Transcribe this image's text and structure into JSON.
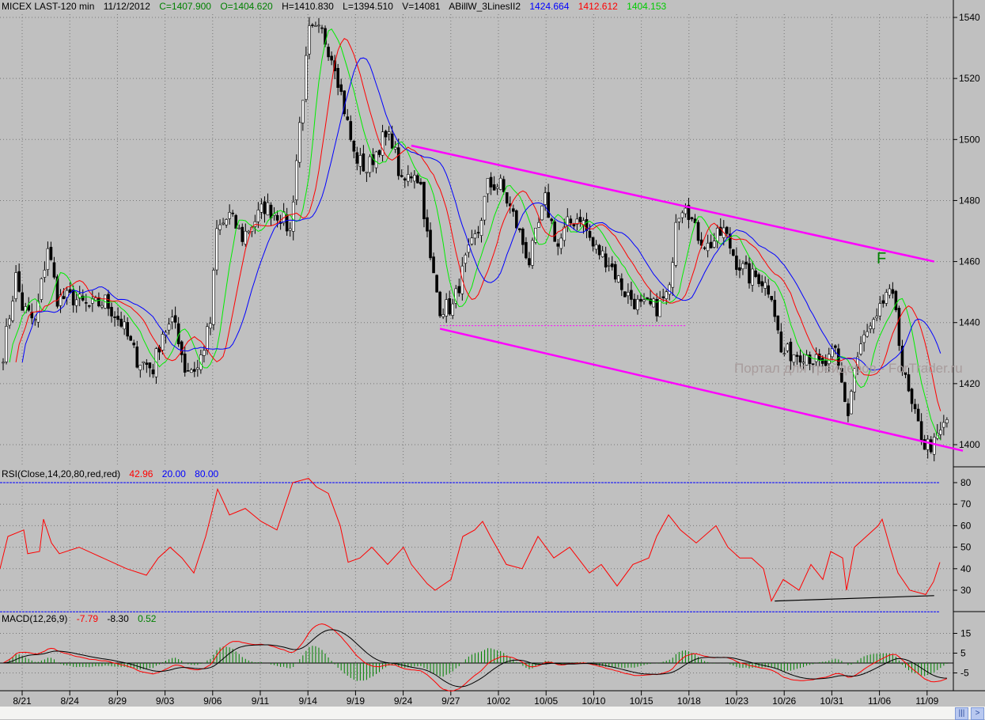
{
  "header": {
    "symbol": "MICEX LAST-120 min",
    "date": "11/12/2012",
    "close": "C=1407.900",
    "open": "O=1404.620",
    "high": "H=1410.830",
    "low": "L=1394.510",
    "volume": "V=14081",
    "indicator": "ABillW_3LinesII2",
    "ind_blue": "1424.664",
    "ind_red": "1412.612",
    "ind_green": "1404.153"
  },
  "rsi_header": {
    "label": "RSI(Close,14,20,80,red,red)",
    "value": "42.96",
    "low": "20.00",
    "high": "80.00"
  },
  "macd_header": {
    "label": "MACD(12,26,9)",
    "macd": "-7.79",
    "signal": "-8.30",
    "hist": "0.52"
  },
  "watermark": "Портал для трейдеров - ForTrader.ru",
  "annotation": "F",
  "colors": {
    "bg": "#c0c0c0",
    "rsi": "#ff0000",
    "trend": "#ff00ff",
    "ma_fast": "#00ee00",
    "ma_mid": "#ff0000",
    "ma_slow": "#0000ff",
    "hist": "#008000"
  },
  "chart_data": {
    "type": "candlestick",
    "price_axis": {
      "ticks": [
        "1540",
        "1520",
        "1500",
        "1480",
        "1460",
        "1440",
        "1420",
        "1400"
      ],
      "range": [
        1390,
        1545
      ]
    },
    "rsi_axis": {
      "ticks": [
        "80",
        "70",
        "60",
        "50",
        "40",
        "30"
      ],
      "levels": [
        20,
        80
      ]
    },
    "macd_axis": {
      "ticks": [
        "15",
        "5",
        "-5"
      ]
    },
    "date_labels": [
      "8/21",
      "8/24",
      "8/29",
      "9/03",
      "9/06",
      "9/11",
      "9/14",
      "9/19",
      "9/24",
      "9/27",
      "10/02",
      "10/05",
      "10/10",
      "10/15",
      "10/18",
      "10/23",
      "10/26",
      "10/31",
      "11/06",
      "11/09"
    ],
    "close_keypoints": [
      [
        0,
        1430
      ],
      [
        4,
        1455
      ],
      [
        6,
        1445
      ],
      [
        10,
        1440
      ],
      [
        14,
        1465
      ],
      [
        17,
        1448
      ],
      [
        22,
        1448
      ],
      [
        27,
        1445
      ],
      [
        32,
        1447
      ],
      [
        37,
        1440
      ],
      [
        42,
        1428
      ],
      [
        47,
        1425
      ],
      [
        50,
        1437
      ],
      [
        54,
        1440
      ],
      [
        57,
        1425
      ],
      [
        61,
        1425
      ],
      [
        65,
        1440
      ],
      [
        67,
        1470
      ],
      [
        71,
        1475
      ],
      [
        75,
        1468
      ],
      [
        82,
        1478
      ],
      [
        87,
        1475
      ],
      [
        90,
        1470
      ],
      [
        93,
        1505
      ],
      [
        96,
        1535
      ],
      [
        100,
        1535
      ],
      [
        104,
        1525
      ],
      [
        107,
        1510
      ],
      [
        110,
        1495
      ],
      [
        114,
        1490
      ],
      [
        119,
        1500
      ],
      [
        122,
        1500
      ],
      [
        125,
        1485
      ],
      [
        129,
        1490
      ],
      [
        131,
        1485
      ],
      [
        134,
        1460
      ],
      [
        137,
        1445
      ],
      [
        141,
        1445
      ],
      [
        145,
        1460
      ],
      [
        149,
        1470
      ],
      [
        152,
        1485
      ],
      [
        156,
        1485
      ],
      [
        160,
        1475
      ],
      [
        165,
        1460
      ],
      [
        170,
        1480
      ],
      [
        174,
        1465
      ],
      [
        177,
        1472
      ],
      [
        181,
        1475
      ],
      [
        185,
        1465
      ],
      [
        190,
        1460
      ],
      [
        195,
        1450
      ],
      [
        200,
        1445
      ],
      [
        205,
        1445
      ],
      [
        209,
        1450
      ],
      [
        211,
        1475
      ],
      [
        214,
        1480
      ],
      [
        217,
        1470
      ],
      [
        221,
        1465
      ],
      [
        226,
        1470
      ],
      [
        230,
        1460
      ],
      [
        234,
        1455
      ],
      [
        237,
        1455
      ],
      [
        241,
        1450
      ],
      [
        244,
        1430
      ],
      [
        247,
        1430
      ],
      [
        252,
        1430
      ],
      [
        257,
        1425
      ],
      [
        261,
        1430
      ],
      [
        265,
        1410
      ],
      [
        267,
        1425
      ],
      [
        270,
        1435
      ],
      [
        274,
        1440
      ],
      [
        277,
        1450
      ],
      [
        280,
        1445
      ],
      [
        282,
        1425
      ],
      [
        285,
        1412
      ],
      [
        289,
        1400
      ],
      [
        292,
        1400
      ],
      [
        296,
        1408
      ]
    ],
    "rsi_keypoints": [
      [
        0,
        40
      ],
      [
        10,
        55
      ],
      [
        30,
        58
      ],
      [
        35,
        47
      ],
      [
        50,
        48
      ],
      [
        55,
        63
      ],
      [
        65,
        52
      ],
      [
        75,
        47
      ],
      [
        100,
        50
      ],
      [
        130,
        45
      ],
      [
        160,
        40
      ],
      [
        185,
        37
      ],
      [
        200,
        45
      ],
      [
        215,
        50
      ],
      [
        230,
        45
      ],
      [
        245,
        38
      ],
      [
        260,
        55
      ],
      [
        275,
        77
      ],
      [
        290,
        65
      ],
      [
        310,
        68
      ],
      [
        330,
        62
      ],
      [
        350,
        58
      ],
      [
        370,
        80
      ],
      [
        390,
        82
      ],
      [
        400,
        78
      ],
      [
        415,
        75
      ],
      [
        430,
        60
      ],
      [
        440,
        43
      ],
      [
        455,
        45
      ],
      [
        470,
        50
      ],
      [
        490,
        42
      ],
      [
        510,
        50
      ],
      [
        520,
        42
      ],
      [
        540,
        33
      ],
      [
        550,
        30
      ],
      [
        570,
        35
      ],
      [
        585,
        55
      ],
      [
        600,
        58
      ],
      [
        610,
        62
      ],
      [
        620,
        55
      ],
      [
        640,
        42
      ],
      [
        660,
        40
      ],
      [
        680,
        55
      ],
      [
        700,
        45
      ],
      [
        720,
        50
      ],
      [
        745,
        38
      ],
      [
        760,
        42
      ],
      [
        780,
        32
      ],
      [
        800,
        42
      ],
      [
        820,
        45
      ],
      [
        830,
        55
      ],
      [
        845,
        65
      ],
      [
        860,
        58
      ],
      [
        880,
        52
      ],
      [
        905,
        60
      ],
      [
        920,
        50
      ],
      [
        935,
        45
      ],
      [
        950,
        45
      ],
      [
        965,
        40
      ],
      [
        975,
        25
      ],
      [
        990,
        35
      ],
      [
        1010,
        30
      ],
      [
        1025,
        42
      ],
      [
        1040,
        35
      ],
      [
        1050,
        48
      ],
      [
        1065,
        45
      ],
      [
        1070,
        30
      ],
      [
        1080,
        50
      ],
      [
        1095,
        55
      ],
      [
        1110,
        60
      ],
      [
        1115,
        63
      ],
      [
        1125,
        50
      ],
      [
        1135,
        38
      ],
      [
        1150,
        30
      ],
      [
        1170,
        28
      ],
      [
        1180,
        34
      ],
      [
        1188,
        43
      ]
    ],
    "trendlines": {
      "upper": [
        [
          128,
          1498
        ],
        [
          292,
          1460
        ]
      ],
      "lower": [
        [
          137,
          1438
        ],
        [
          301,
          1398
        ]
      ],
      "support_dotted": [
        [
          137,
          1439
        ],
        [
          214,
          1439
        ]
      ],
      "rsi_support": [
        [
          242,
          25
        ],
        [
          292,
          27.5
        ]
      ]
    }
  }
}
